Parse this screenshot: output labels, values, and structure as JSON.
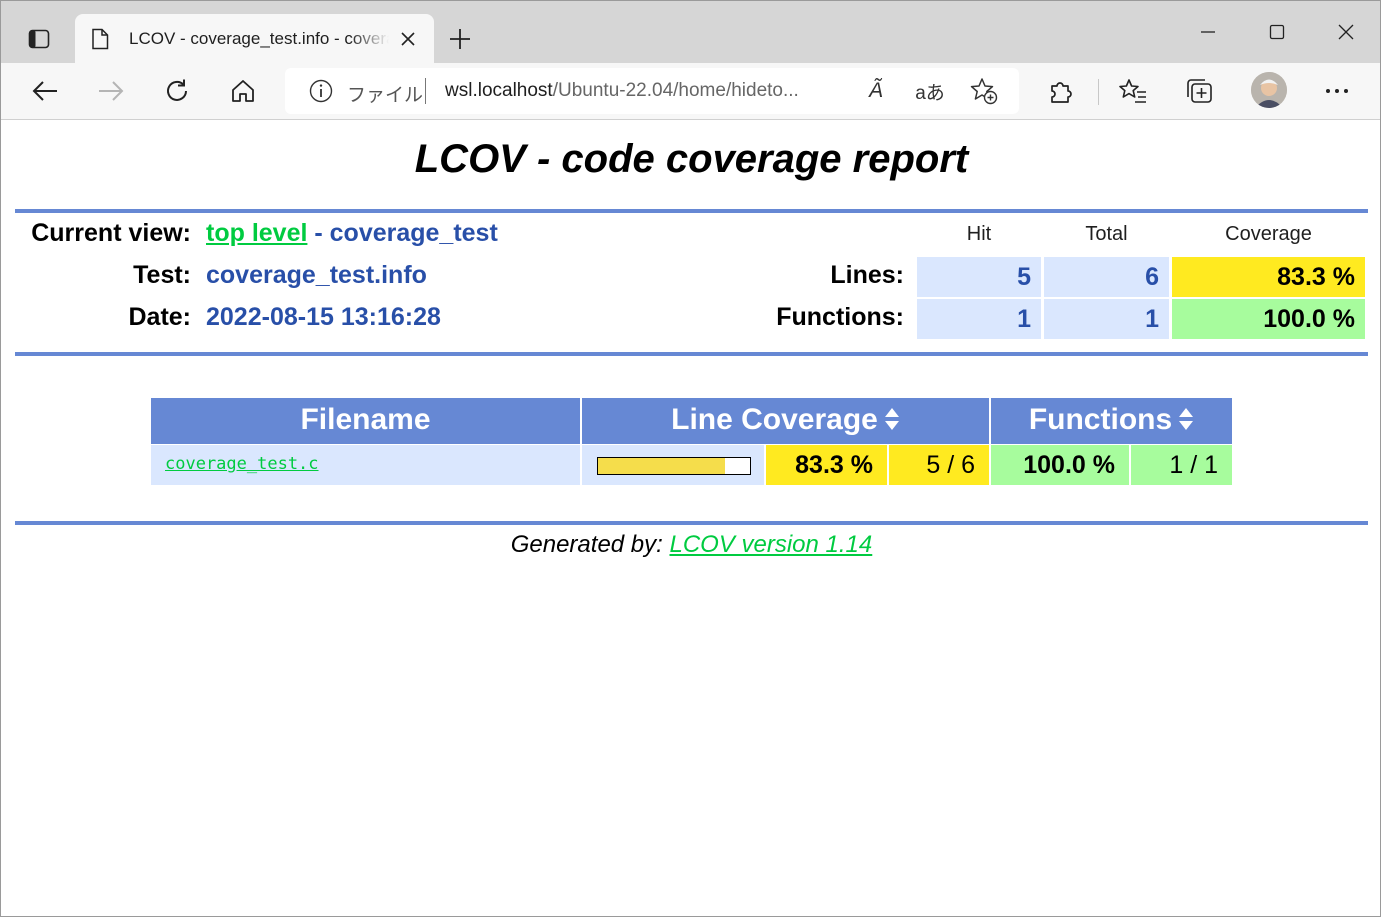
{
  "browser": {
    "tab_title": "LCOV - coverage_test.info - coverage_test",
    "address": {
      "scheme_label": "ファイル",
      "host": "wsl.localhost",
      "path": "/Ubuntu-22.04/home/hideto..."
    },
    "icons": {
      "read_aloud": "Ã",
      "translate": "aあ"
    }
  },
  "report": {
    "title": "LCOV - code coverage report",
    "header": {
      "current_view_label": "Current view:",
      "current_view_link": "top level",
      "current_view_rest": " - coverage_test",
      "test_label": "Test:",
      "test_value": "coverage_test.info",
      "date_label": "Date:",
      "date_value": "2022-08-15 13:16:28",
      "columns": {
        "hit": "Hit",
        "total": "Total",
        "coverage": "Coverage"
      },
      "lines": {
        "label": "Lines:",
        "hit": "5",
        "total": "6",
        "coverage": "83.3 %"
      },
      "functions": {
        "label": "Functions:",
        "hit": "1",
        "total": "1",
        "coverage": "100.0 %"
      }
    },
    "table": {
      "col_filename": "Filename",
      "col_line_coverage": "Line Coverage",
      "col_functions": "Functions",
      "rows": [
        {
          "filename": "coverage_test.c",
          "line_fraction": 0.833,
          "line_rate": "83.3 %",
          "line_hits": "5 / 6",
          "func_rate": "100.0 %",
          "func_hits": "1 / 1"
        }
      ]
    },
    "footer": {
      "prefix": "Generated by: ",
      "link": "LCOV version 1.14"
    },
    "colors": {
      "ruler": "#6688d4",
      "link": "#00cb40",
      "value": "#284fa8",
      "low_coverage": "#ffea20",
      "high_coverage": "#a7fc9d",
      "cell_bg": "#dae7fe"
    }
  }
}
